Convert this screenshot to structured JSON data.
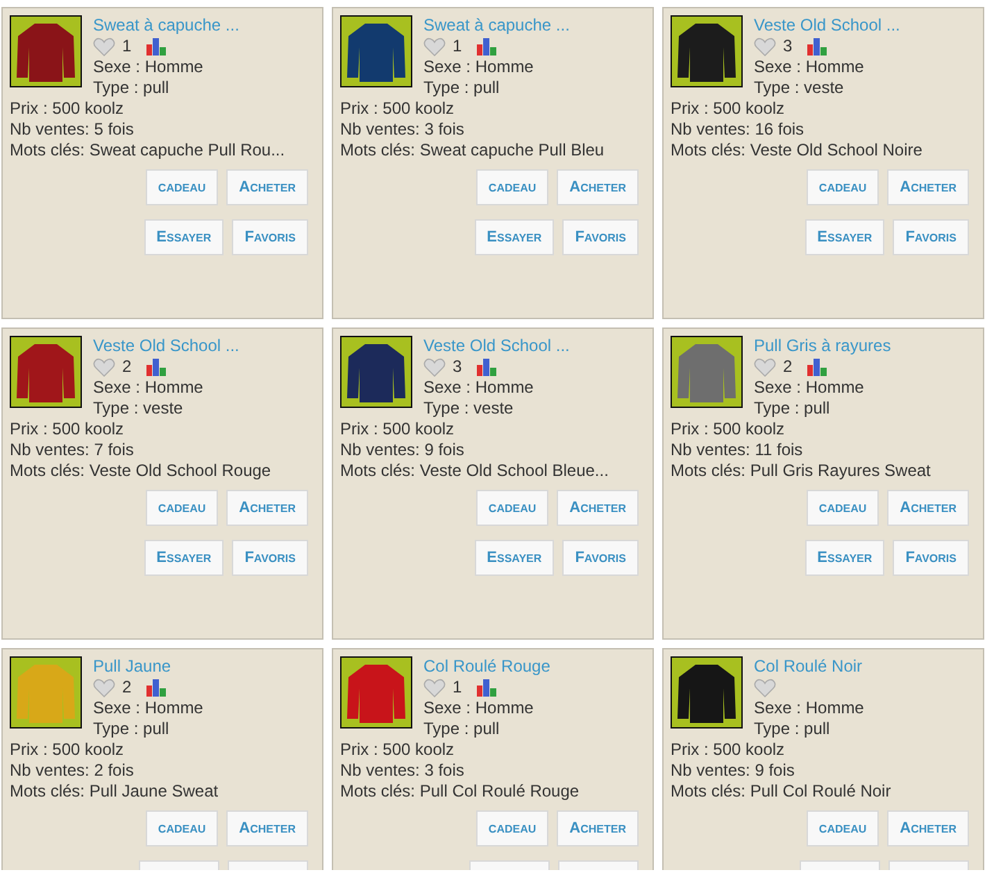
{
  "items": [
    {
      "title": "Sweat à capuche ...",
      "color": "#8a1418",
      "likes": "1",
      "stats": true,
      "sexe": "Sexe : Homme",
      "type": "Type : pull",
      "price": "Prix : 500 koolz",
      "sales": "Nb ventes: 5 fois",
      "keywords": "Mots clés: Sweat capuche Pull Rou...",
      "buttons": [
        [
          "cadeau",
          "Acheter"
        ],
        [
          "Essayer",
          "Favoris"
        ]
      ]
    },
    {
      "title": "Sweat à capuche ...",
      "color": "#123a6e",
      "likes": "1",
      "stats": true,
      "sexe": "Sexe : Homme",
      "type": "Type : pull",
      "price": "Prix : 500 koolz",
      "sales": "Nb ventes: 3 fois",
      "keywords": "Mots clés: Sweat capuche Pull Bleu",
      "buttons": [
        [
          "cadeau",
          "Acheter"
        ],
        [
          "Essayer",
          "Favoris"
        ]
      ]
    },
    {
      "title": "Veste Old School ...",
      "color": "#1c1c1c",
      "likes": "3",
      "stats": true,
      "sexe": "Sexe : Homme",
      "type": "Type : veste",
      "price": "Prix : 500 koolz",
      "sales": "Nb ventes: 16 fois",
      "keywords": "Mots clés: Veste Old School Noire",
      "buttons": [
        [
          "cadeau",
          "Acheter"
        ],
        [
          "Essayer",
          "Favoris"
        ]
      ]
    },
    {
      "title": "Veste Old School ...",
      "color": "#a0161a",
      "likes": "2",
      "stats": true,
      "sexe": "Sexe : Homme",
      "type": "Type : veste",
      "price": "Prix : 500 koolz",
      "sales": "Nb ventes: 7 fois",
      "keywords": "Mots clés: Veste Old School Rouge",
      "buttons": [
        [
          "cadeau",
          "Acheter"
        ],
        [
          "Essayer",
          "Favoris"
        ]
      ]
    },
    {
      "title": "Veste Old School ...",
      "color": "#1c2a5a",
      "likes": "3",
      "stats": true,
      "sexe": "Sexe : Homme",
      "type": "Type : veste",
      "price": "Prix : 500 koolz",
      "sales": "Nb ventes: 9 fois",
      "keywords": "Mots clés: Veste Old School Bleue...",
      "buttons": [
        [
          "cadeau",
          "Acheter"
        ],
        [
          "Essayer",
          "Favoris"
        ]
      ]
    },
    {
      "title": "Pull Gris à rayures",
      "color": "#6e6e6e",
      "likes": "2",
      "stats": true,
      "sexe": "Sexe : Homme",
      "type": "Type : pull",
      "price": "Prix : 500 koolz",
      "sales": "Nb ventes: 11 fois",
      "keywords": "Mots clés: Pull Gris Rayures Sweat",
      "buttons": [
        [
          "cadeau",
          "Acheter"
        ],
        [
          "Essayer",
          "Favoris"
        ]
      ]
    },
    {
      "title": "Pull Jaune",
      "color": "#d8a818",
      "likes": "2",
      "stats": true,
      "sexe": "Sexe : Homme",
      "type": "Type : pull",
      "price": "Prix : 500 koolz",
      "sales": "Nb ventes: 2 fois",
      "keywords": "Mots clés: Pull Jaune Sweat",
      "buttons": [
        [
          "cadeau",
          "Acheter"
        ]
      ],
      "cut_row": true
    },
    {
      "title": "Col Roulé Rouge",
      "color": "#c8141a",
      "likes": "1",
      "stats": true,
      "sexe": "Sexe : Homme",
      "type": "Type : pull",
      "price": "Prix : 500 koolz",
      "sales": "Nb ventes: 3 fois",
      "keywords": "Mots clés: Pull Col Roulé Rouge",
      "buttons": [
        [
          "cadeau",
          "Acheter"
        ]
      ],
      "cut_row": true
    },
    {
      "title": "Col Roulé Noir",
      "color": "#161616",
      "stats": false,
      "sexe": "Sexe : Homme",
      "type": "Type : pull",
      "price": "Prix : 500 koolz",
      "sales": "Nb ventes: 9 fois",
      "keywords": "Mots clés: Pull Col Roulé Noir",
      "buttons": [
        [
          "cadeau",
          "Acheter"
        ]
      ],
      "cut_row": true
    }
  ]
}
